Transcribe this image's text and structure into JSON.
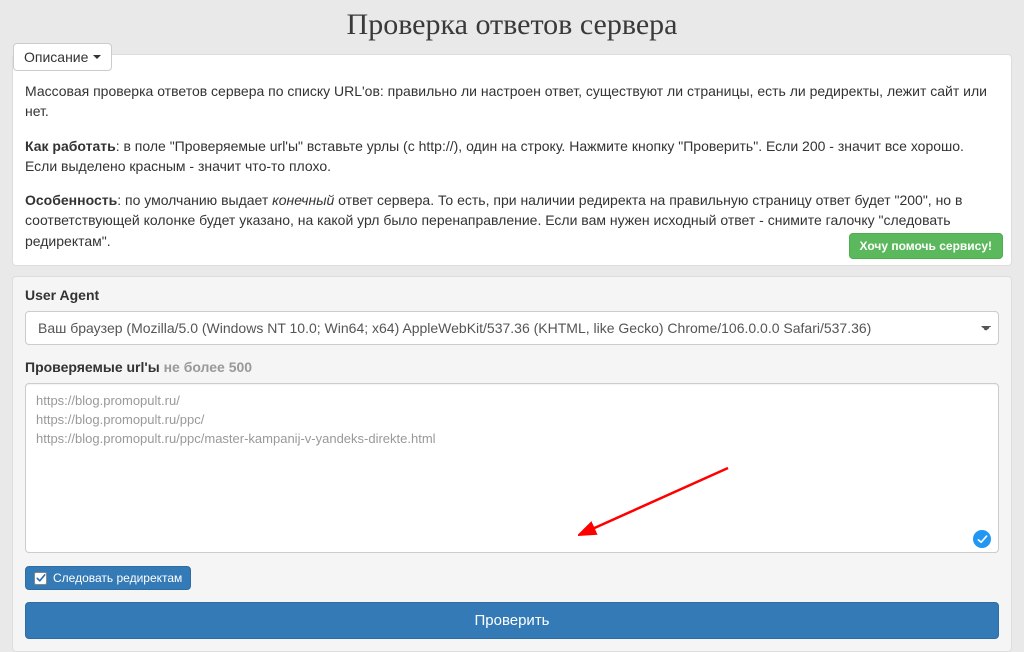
{
  "title": "Проверка ответов сервера",
  "description_toggle": "Описание",
  "description": {
    "p1": "Массовая проверка ответов сервера по списку URL'ов: правильно ли настроен ответ, существуют ли страницы, есть ли редиректы, лежит сайт или нет.",
    "p2_bold": "Как работать",
    "p2_rest": ": в поле \"Проверяемые url'ы\" вставьте урлы (с http://), один на строку. Нажмите кнопку \"Проверить\". Если 200 - значит все хорошо. Если выделено красным - значит что-то плохо.",
    "p3_bold": "Особенность",
    "p3_a": ": по умолчанию выдает ",
    "p3_em": "конечный",
    "p3_b": " ответ сервера. То есть, при наличии редиректа на правильную страницу ответ будет \"200\", но в соответствующей колонке будет указано, на какой урл было перенаправление. Если вам нужен исходный ответ - снимите галочку \"следовать редиректам\"."
  },
  "help_button": "Хочу помочь сервису!",
  "form": {
    "user_agent_label": "User Agent",
    "user_agent_value": "Ваш браузер (Mozilla/5.0 (Windows NT 10.0; Win64; x64) AppleWebKit/537.36 (KHTML, like Gecko) Chrome/106.0.0.0 Safari/537.36)",
    "urls_label": "Проверяемые url'ы",
    "urls_limit": " не более 500",
    "urls_value": "https://blog.promopult.ru/\nhttps://blog.promopult.ru/ppc/\nhttps://blog.promopult.ru/ppc/master-kampanij-v-yandeks-direkte.html",
    "follow_redirects_label": "Следовать редиректам",
    "follow_redirects_checked": true,
    "submit_label": "Проверить"
  },
  "icons": {
    "caret": "caret-down",
    "check": "check-circle"
  },
  "colors": {
    "primary": "#337ab7",
    "success": "#5cb85c",
    "accent_arrow": "#ff0000"
  }
}
